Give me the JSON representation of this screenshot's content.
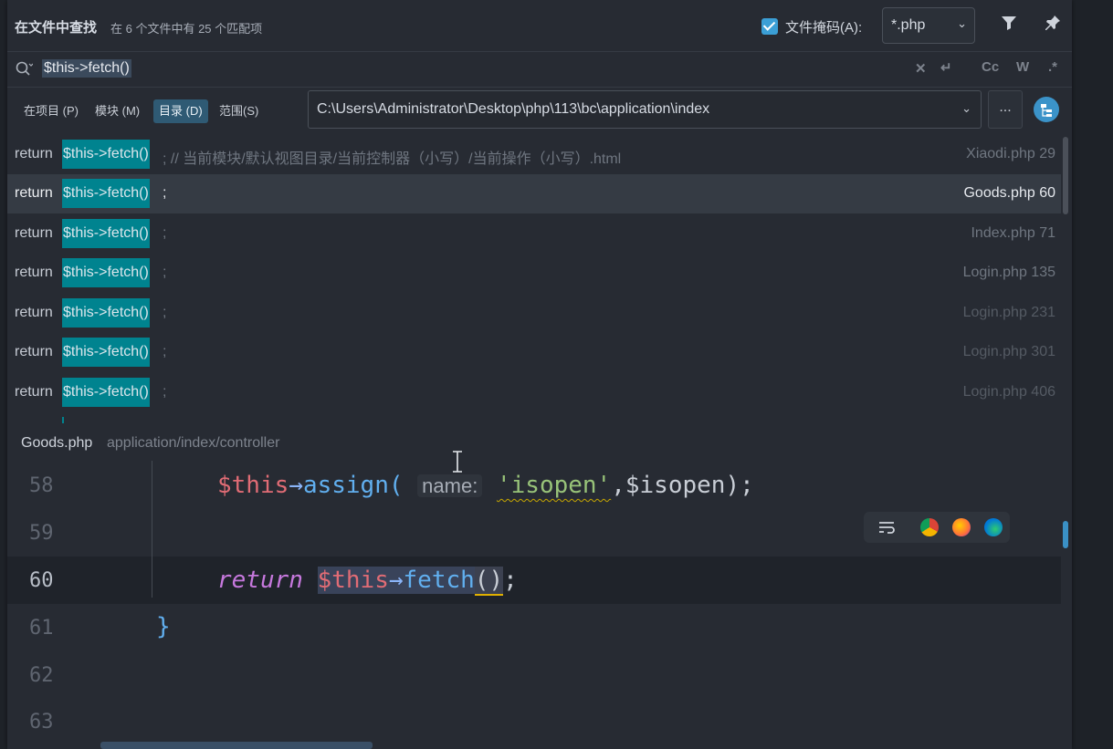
{
  "header": {
    "title": "在文件中查找",
    "match_count": "在 6 个文件中有 25 个匹配项",
    "file_mask_label": "文件掩码(A):",
    "file_mask_checked": true,
    "file_mask_value": "*.php"
  },
  "search": {
    "query": "$this->fetch()",
    "options": [
      "Cc",
      "W",
      ".*"
    ]
  },
  "scope": {
    "buttons": [
      "在项目 (P)",
      "模块 (M)",
      "目录 (D)",
      "范围(S)"
    ],
    "active": "目录 (D)",
    "directory": "C:\\Users\\Administrator\\Desktop\\php\\113\\bc\\application\\index",
    "browse_label": "..."
  },
  "results": [
    {
      "keyword": "return",
      "match": "$this->fetch()",
      "after": "; // 当前模块/默认视图目录/当前控制器（小写）/当前操作（小写）.html",
      "file": "Xiaodi.php 29"
    },
    {
      "keyword": "return",
      "match": "$this->fetch()",
      "after": ";",
      "file": "Goods.php 60"
    },
    {
      "keyword": "return",
      "match": "$this->fetch()",
      "after": ";",
      "file": "Index.php 71"
    },
    {
      "keyword": "return",
      "match": "$this->fetch()",
      "after": ";",
      "file": "Login.php 135"
    },
    {
      "keyword": "return",
      "match": "$this->fetch()",
      "after": ";",
      "file": "Login.php 231"
    },
    {
      "keyword": "return",
      "match": "$this->fetch()",
      "after": ";",
      "file": "Login.php 301"
    },
    {
      "keyword": "return",
      "match": "$this->fetch()",
      "after": ";",
      "file": "Login.php 406"
    }
  ],
  "preview": {
    "file": "Goods.php",
    "path": "application/index/controller",
    "lines": [
      "58",
      "59",
      "60",
      "61",
      "62",
      "63"
    ],
    "code": {
      "l58_var": "$this",
      "l58_op": "→",
      "l58_fn": "assign(",
      "l58_hint": "name:",
      "l58_str": "'isopen'",
      "l58_rest": ",$isopen);",
      "l60_kw": "return",
      "l60_var": "$this",
      "l60_op": "→",
      "l60_fn": "fetch",
      "l60_paren": "()",
      "l60_end": ";",
      "l61": "}"
    }
  },
  "colors": {
    "accent": "#3b9fd6",
    "match_highlight": "#00838f"
  }
}
